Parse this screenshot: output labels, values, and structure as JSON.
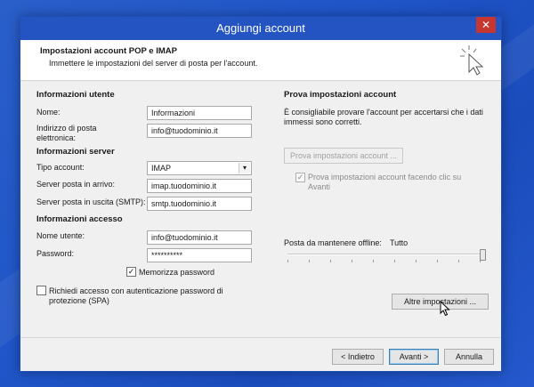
{
  "window": {
    "title": "Aggiungi account",
    "close_label": "✕"
  },
  "header": {
    "title": "Impostazioni account POP e IMAP",
    "subtitle": "Immettere le impostazioni del server di posta per l'account."
  },
  "user_info": {
    "title": "Informazioni utente",
    "name_label": "Nome:",
    "name_value": "Informazioni",
    "email_label_line1": "Indirizzo di posta",
    "email_label_line2": "elettronica:",
    "email_value": "info@tuodominio.it"
  },
  "server_info": {
    "title": "Informazioni server",
    "account_type_label": "Tipo account:",
    "account_type_value": "IMAP",
    "incoming_label": "Server posta in arrivo:",
    "incoming_value": "imap.tuodominio.it",
    "outgoing_label": "Server posta in uscita (SMTP):",
    "outgoing_value": "smtp.tuodominio.it"
  },
  "access_info": {
    "title": "Informazioni accesso",
    "username_label": "Nome utente:",
    "username_value": "info@tuodominio.it",
    "password_label": "Password:",
    "password_value": "**********",
    "remember_label": "Memorizza password",
    "remember_checked": true,
    "spa_label_line1": "Richiedi accesso con autenticazione password di",
    "spa_label_line2": "protezione (SPA)",
    "spa_checked": false
  },
  "test": {
    "title": "Prova impostazioni account",
    "description_line1": "È consigliabile provare l'account per accertarsi che i dati",
    "description_line2": "immessi sono corretti.",
    "test_button": "Prova impostazioni account ...",
    "auto_test_line1": "Prova impostazioni account facendo clic su",
    "auto_test_line2": "Avanti",
    "auto_test_checked": true
  },
  "offline": {
    "label": "Posta da mantenere offline:",
    "value": "Tutto",
    "slider_fraction": 1.0
  },
  "more_settings_button": "Altre impostazioni ...",
  "footer": {
    "back": "< Indietro",
    "next": "Avanti >",
    "cancel": "Annulla"
  },
  "icons": {
    "check": "✓",
    "dropdown": "chevron-down-icon",
    "cursor": "arrow-cursor"
  }
}
